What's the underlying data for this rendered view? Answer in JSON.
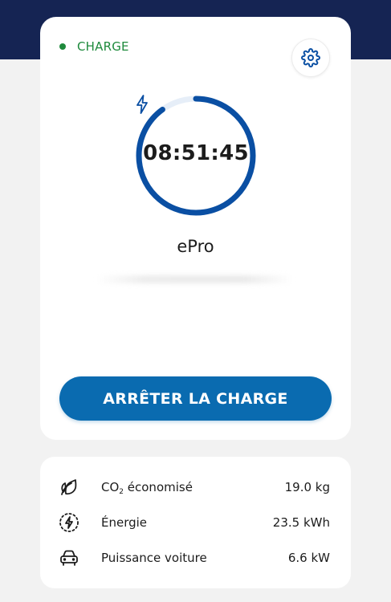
{
  "status": {
    "label": "CHARGE",
    "color": "#1e8a3c"
  },
  "settings": {
    "icon": "gear-icon"
  },
  "charging": {
    "icon": "bolt-icon",
    "timer": "08:51:45",
    "progress_fraction": 0.9,
    "ring_color": "#0a4fa3",
    "track_color": "#e6eef8"
  },
  "device": {
    "name": "ePro"
  },
  "actions": {
    "stop_label": "ARRÊTER LA CHARGE",
    "stop_color": "#0a6bb0"
  },
  "stats": {
    "co2": {
      "icon": "leaf-icon",
      "label_main": "CO",
      "label_sub": "2",
      "label_rest": " économisé",
      "value": "19.0 kg"
    },
    "energy": {
      "icon": "energy-icon",
      "label": "Énergie",
      "value": "23.5 kWh"
    },
    "power": {
      "icon": "car-icon",
      "label": "Puissance voiture",
      "value": "6.6 kW"
    }
  },
  "colors": {
    "header_band": "#152453",
    "page_background": "#f2f2f2"
  }
}
